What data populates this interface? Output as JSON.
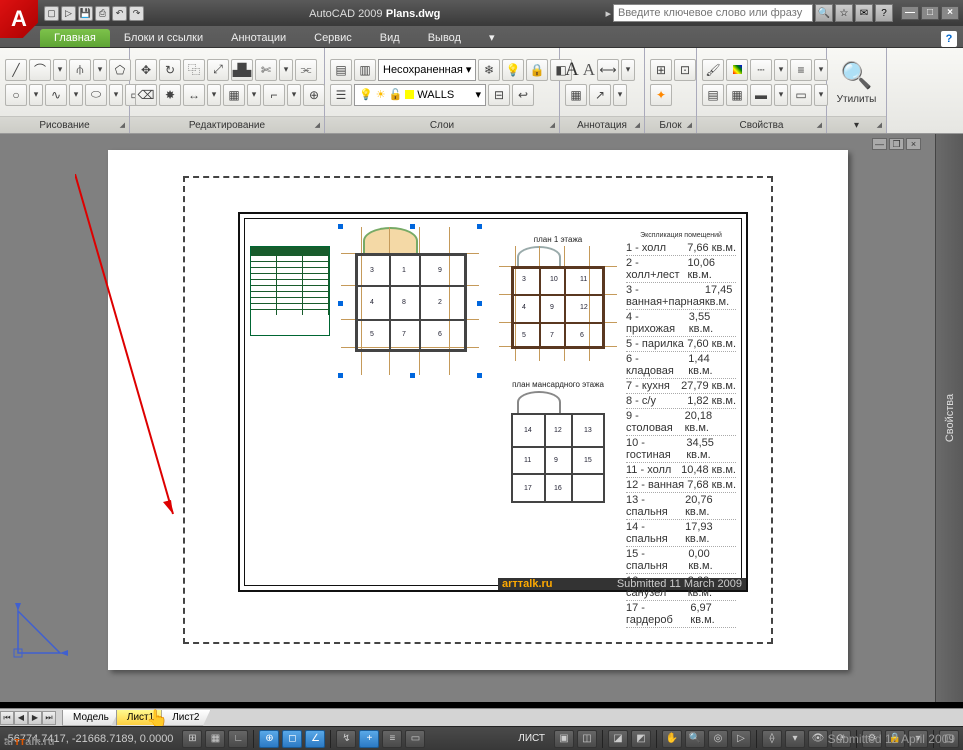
{
  "title": {
    "app": "AutoCAD 2009",
    "file": "Plans.dwg"
  },
  "search_placeholder": "Введите ключевое слово или фразу",
  "tabs": [
    "Главная",
    "Блоки и ссылки",
    "Аннотации",
    "Сервис",
    "Вид",
    "Вывод"
  ],
  "panels": {
    "draw": "Рисование",
    "modify": "Редактирование",
    "layers": "Слои",
    "anno": "Аннотация",
    "block": "Блок",
    "props": "Свойства",
    "util": "Утилиты"
  },
  "layer_combo1": "Несохраненная",
  "layer_combo2": "WALLS",
  "anno_letter": "A",
  "props_panel_label": "Свойства",
  "layout_tabs": [
    "Модель",
    "Лист1",
    "Лист2"
  ],
  "status": {
    "coords": "-56774.7417, -21668.7189, 0.0000",
    "mode": "ЛИСТ"
  },
  "sheet": {
    "plan1_title": "план 1 этажа",
    "plan2_title": "план мансардного этажа",
    "spec_title": "Экспликация помещений",
    "spec_rows": [
      [
        "1 - холл",
        "7,66 кв.м."
      ],
      [
        "2 - холл+лест",
        "10,06 кв.м."
      ],
      [
        "3 - ванная+парная",
        "17,45 кв.м."
      ],
      [
        "4 - прихожая",
        "3,55 кв.м."
      ],
      [
        "5 - парилка",
        "7,60 кв.м."
      ],
      [
        "6 - кладовая",
        "1,44 кв.м."
      ],
      [
        "7 - кухня",
        "27,79 кв.м."
      ],
      [
        "8 - с/у",
        "1,82 кв.м."
      ],
      [
        "9 - столовая",
        "20,18 кв.м."
      ],
      [
        "10 - гостиная",
        "34,55 кв.м."
      ],
      [
        "11 - холл",
        "10,48 кв.м."
      ],
      [
        "12 - ванная",
        "7,68 кв.м."
      ],
      [
        "13 - спальня",
        "20,76 кв.м."
      ],
      [
        "14 - спальня",
        "17,93 кв.м."
      ],
      [
        "15 - спальня",
        "0,00 кв.м."
      ],
      [
        "16 - санузел",
        "3,60 кв.м."
      ],
      [
        "17 - гардероб",
        "6,97 кв.м."
      ]
    ],
    "titleblock_logo": "arттalk.ru",
    "titleblock_date": "Submitted 11 March 2009"
  },
  "watermark": {
    "text1": "ar",
    "text2": "тт",
    "text3": "alk.ru"
  },
  "submitted": "Submitted 12 April 2009"
}
